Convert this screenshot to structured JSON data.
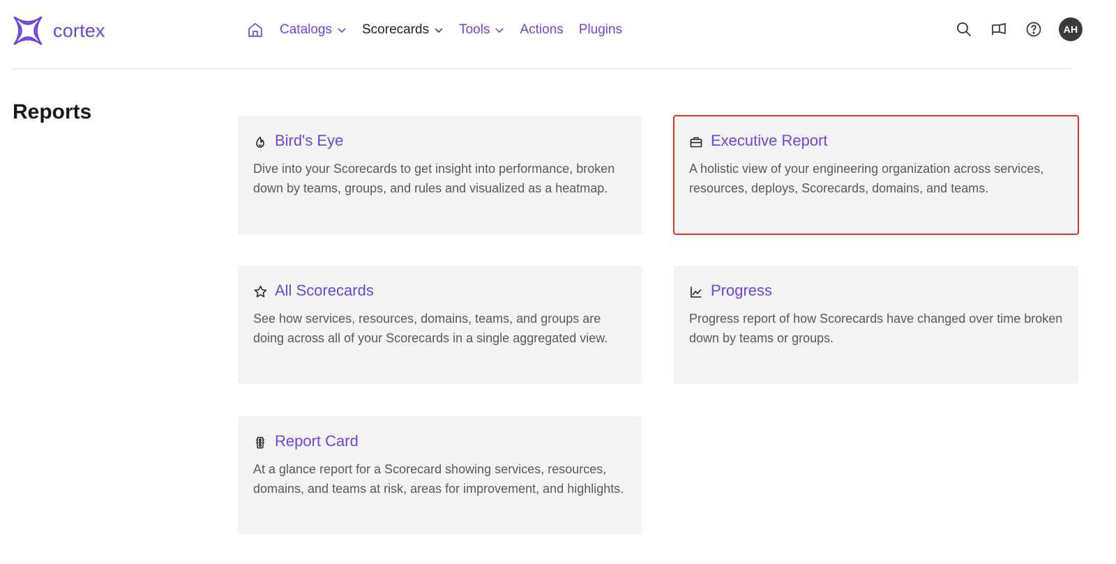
{
  "brand": {
    "name": "cortex",
    "logo_icon": "cortex-logo-icon"
  },
  "nav": {
    "home_icon": "home-icon",
    "items": [
      {
        "label": "Catalogs",
        "dropdown": true,
        "active": false
      },
      {
        "label": "Scorecards",
        "dropdown": true,
        "active": true
      },
      {
        "label": "Tools",
        "dropdown": true,
        "active": false
      },
      {
        "label": "Actions",
        "dropdown": false,
        "active": false
      },
      {
        "label": "Plugins",
        "dropdown": false,
        "active": false
      }
    ]
  },
  "top_actions": {
    "icons": [
      "search-icon",
      "megaphone-icon",
      "help-icon"
    ],
    "avatar_initials": "AH"
  },
  "page": {
    "title": "Reports"
  },
  "reports": [
    {
      "title": "Bird's Eye",
      "icon": "flame-icon",
      "description": "Dive into your Scorecards to get insight into performance, broken down by teams, groups, and rules and visualized as a heatmap.",
      "highlighted": false
    },
    {
      "title": "Executive Report",
      "icon": "briefcase-icon",
      "description": "A holistic view of your engineering organization across services, resources, deploys, Scorecards, domains, and teams.",
      "highlighted": true
    },
    {
      "title": "All Scorecards",
      "icon": "star-icon",
      "description": "See how services, resources, domains, teams, and groups are doing across all of your Scorecards in a single aggregated view.",
      "highlighted": false
    },
    {
      "title": "Progress",
      "icon": "line-chart-icon",
      "description": "Progress report of how Scorecards have changed over time broken down by teams or groups.",
      "highlighted": false
    },
    {
      "title": "Report Card",
      "icon": "traffic-light-icon",
      "description": "At a glance report for a Scorecard showing services, resources, domains, and teams at risk, areas for improvement, and highlights.",
      "highlighted": false
    }
  ],
  "colors": {
    "accent": "#6B46E5",
    "card_bg": "#f4f4f4",
    "highlight_border": "#e0342b",
    "avatar_bg": "#3b3b3b"
  }
}
